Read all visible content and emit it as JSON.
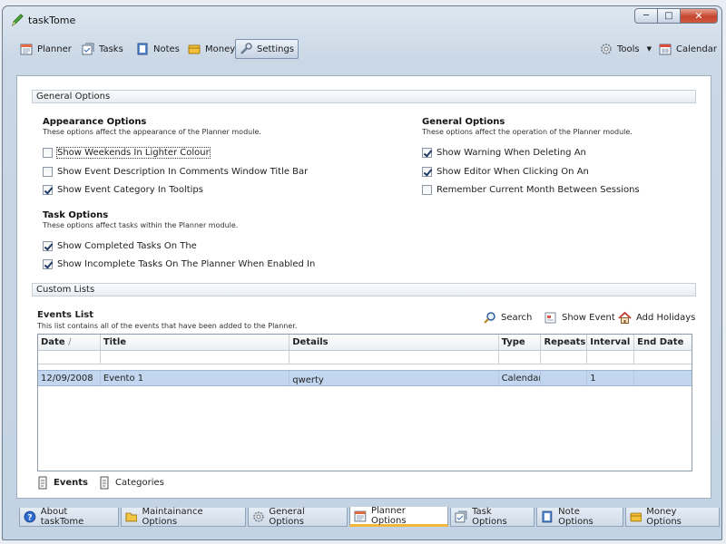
{
  "window": {
    "title": "taskTome"
  },
  "toolbar": {
    "items": [
      {
        "label": "Planner"
      },
      {
        "label": "Tasks"
      },
      {
        "label": "Notes"
      },
      {
        "label": "Money"
      },
      {
        "label": "Settings"
      }
    ],
    "tools_label": "Tools",
    "calendar_label": "Calendar"
  },
  "general_section": {
    "header": "General Options"
  },
  "appearance": {
    "title": "Appearance Options",
    "desc": "These options affect the appearance of the Planner module.",
    "options": [
      {
        "label": "Show Weekends In Lighter Colour",
        "checked": false
      },
      {
        "label": "Show Event Description In Comments Window Title Bar",
        "checked": false
      },
      {
        "label": "Show Event Category In Tooltips",
        "checked": true
      }
    ]
  },
  "general_opts": {
    "title": "General Options",
    "desc": "These options affect the operation of the Planner module.",
    "options": [
      {
        "label": "Show Warning When Deleting An",
        "checked": true
      },
      {
        "label": "Show Editor When Clicking On An",
        "checked": true
      },
      {
        "label": "Remember Current Month Between Sessions",
        "checked": false
      }
    ]
  },
  "task_opts": {
    "title": "Task Options",
    "desc": "These options affect tasks within the Planner module.",
    "options": [
      {
        "label": "Show Completed Tasks On The",
        "checked": true
      },
      {
        "label": "Show Incomplete Tasks On The Planner When Enabled In",
        "checked": true
      }
    ]
  },
  "custom_section": {
    "header": "Custom Lists"
  },
  "events": {
    "title": "Events List",
    "desc": "This list contains all of the events that have been added to the Planner.",
    "search_label": "Search",
    "show_event_label": "Show Event",
    "add_holidays_label": "Add Holidays",
    "columns": [
      "Date",
      "Title",
      "Details",
      "Type",
      "Repeats",
      "Interval",
      "End Date"
    ],
    "sort_indicator": "/",
    "rows": [
      {
        "date": "12/09/2008",
        "title": "Evento 1",
        "details": "qwerty",
        "type": "Calendar",
        "repeats": "",
        "interval": "1",
        "end_date": ""
      }
    ]
  },
  "subtabs": [
    {
      "label": "Events"
    },
    {
      "label": "Categories"
    }
  ],
  "bottom_tabs": [
    {
      "label": "About taskTome"
    },
    {
      "label": "Maintainance Options"
    },
    {
      "label": "General Options"
    },
    {
      "label": "Planner Options"
    },
    {
      "label": "Task Options"
    },
    {
      "label": "Note Options"
    },
    {
      "label": "Money Options"
    }
  ],
  "colors": {
    "selection": "#c2d6ef",
    "active_tab_accent": "#f3b53a",
    "close_button": "#c5452e"
  }
}
